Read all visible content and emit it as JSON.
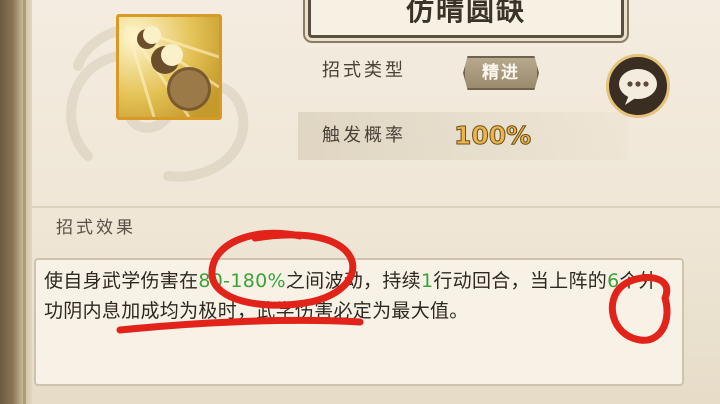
{
  "title": "仿晴圆缺",
  "fields": {
    "type_label": "招式类型",
    "type_value": "精进",
    "rate_label": "触发概率",
    "rate_value": "100%"
  },
  "effect": {
    "section_label": "招式效果",
    "segments": [
      {
        "text": "使自身武学伤害在",
        "color": "default"
      },
      {
        "text": "80-180%",
        "color": "green"
      },
      {
        "text": "之间波动，持续",
        "color": "default"
      },
      {
        "text": "1",
        "color": "green"
      },
      {
        "text": "行动回合，当上阵的",
        "color": "default"
      },
      {
        "text": "6",
        "color": "green"
      },
      {
        "text": "个外功阴内息加成均为极时，武学伤害必定为最大值。",
        "color": "default"
      }
    ]
  },
  "icons": {
    "skill": "moon-phases-skill-icon",
    "chat": "speech-bubble-icon",
    "decoration": "cloud-pattern"
  },
  "colors": {
    "panel": "#efe6d6",
    "highlight_green": "#3fa13a",
    "rate_gold": "#e8b64a",
    "annotation_red": "#e2231a"
  }
}
